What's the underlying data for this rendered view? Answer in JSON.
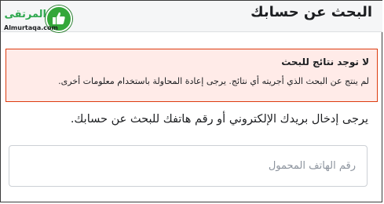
{
  "header": {
    "title": "البحث عن حسابك",
    "logo": {
      "name": "المرتقى",
      "domain": "Almurtaqa.com",
      "icon": "thumbs-up-icon",
      "color": "#34a73a"
    }
  },
  "alert": {
    "title": "لا توجد نتائج للبحث",
    "message": "لم ينتج عن البحث الذي أجريته أي نتائج. يرجى إعادة المحاولة باستخدام معلومات أخرى.",
    "background": "#ffebe8",
    "border": "#dd3c10"
  },
  "form": {
    "instruction": "يرجى إدخال بريدك الإلكتروني أو رقم هاتفك للبحث عن حسابك.",
    "input": {
      "value": "",
      "placeholder": "رقم الهاتف المحمول"
    }
  }
}
